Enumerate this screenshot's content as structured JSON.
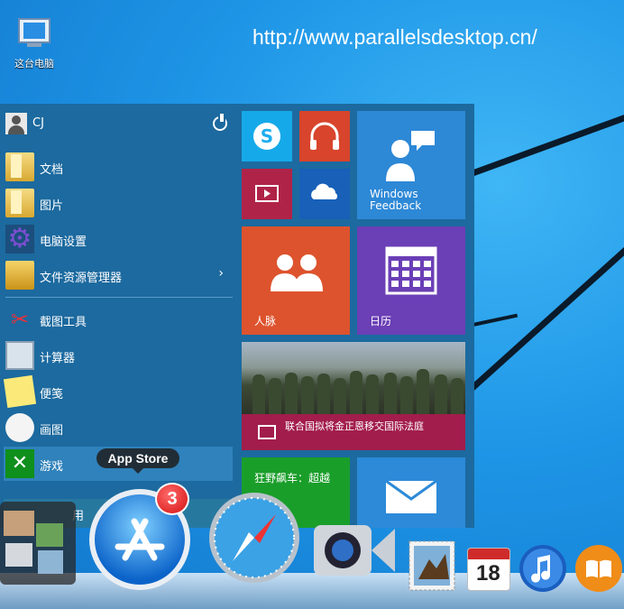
{
  "desktop": {
    "icon_label": "这台电脑",
    "watermark": "http://www.parallelsdesktop.cn/"
  },
  "start_menu": {
    "user_name": "CJ",
    "items": [
      {
        "label": "文档",
        "icon": "documents-folder-icon"
      },
      {
        "label": "图片",
        "icon": "pictures-folder-icon"
      },
      {
        "label": "电脑设置",
        "icon": "pc-settings-gear-icon"
      },
      {
        "label": "文件资源管理器",
        "icon": "file-explorer-icon",
        "has_submenu": true
      },
      {
        "label": "截图工具",
        "icon": "snipping-tool-icon"
      },
      {
        "label": "计算器",
        "icon": "calculator-icon"
      },
      {
        "label": "便笺",
        "icon": "sticky-notes-icon"
      },
      {
        "label": "画图",
        "icon": "paint-icon"
      },
      {
        "label": "游戏",
        "icon": "games-icon"
      }
    ],
    "all_apps_label": "用",
    "submenu_chevron": "›"
  },
  "tiles": {
    "skype": {
      "glyph": "S",
      "color": "#16a9e9"
    },
    "music": {
      "color": "#d8442c"
    },
    "video": {
      "color": "#b02348"
    },
    "onedrive": {
      "color": "#1860b8"
    },
    "feedback": {
      "label_line1": "Windows",
      "label_line2": "Feedback",
      "color": "#2d88d6"
    },
    "people": {
      "label": "人脉",
      "color": "#dd532e"
    },
    "calendar": {
      "label": "日历",
      "color": "#6b3fb6"
    },
    "news": {
      "headline": "联合国拟将金正恩移交国际法庭",
      "color": "#a21d4b"
    },
    "games_tile": {
      "label": "狂野飙车：超越",
      "color": "#1a9e2a"
    },
    "mail": {
      "color": "#2c8ad8"
    }
  },
  "dock": {
    "tooltip": "App Store",
    "badge_count": "3",
    "calendar_day": "18",
    "apps": [
      "stacks-icon",
      "app-store-icon",
      "safari-icon",
      "facetime-icon",
      "mail-stamp-icon",
      "calendar-icon",
      "itunes-icon",
      "ibooks-icon"
    ]
  }
}
